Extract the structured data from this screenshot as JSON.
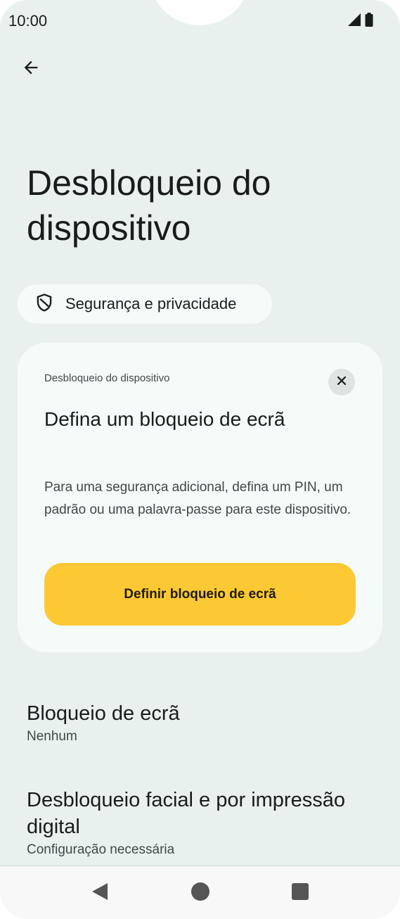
{
  "status_bar": {
    "time": "10:00",
    "icons": [
      "signal-icon",
      "battery-icon"
    ]
  },
  "header": {
    "back_icon": "arrow-back-icon",
    "title": "Desbloqueio do dispositivo"
  },
  "breadcrumb_chip": {
    "icon": "shield-icon",
    "label": "Segurança e privacidade"
  },
  "suggestion_card": {
    "overline": "Desbloqueio do dispositivo",
    "close_icon": "close-icon",
    "title": "Defina um bloqueio de ecrã",
    "body": "Para uma segurança adicional, defina um PIN, um padrão ou uma palavra-passe para este dispositivo.",
    "button_label": "Definir bloqueio de ecrã"
  },
  "preferences": [
    {
      "title": "Bloqueio de ecrã",
      "summary": "Nenhum"
    },
    {
      "title": "Desbloqueio facial e por impressão digital",
      "summary": "Configuração necessária"
    }
  ],
  "nav_bar": {
    "buttons": [
      "nav-back-icon",
      "nav-home-icon",
      "nav-recents-icon"
    ]
  },
  "colors": {
    "background": "#e9f1ef",
    "card": "#f4fbf9",
    "accent_button": "#fcc934"
  }
}
